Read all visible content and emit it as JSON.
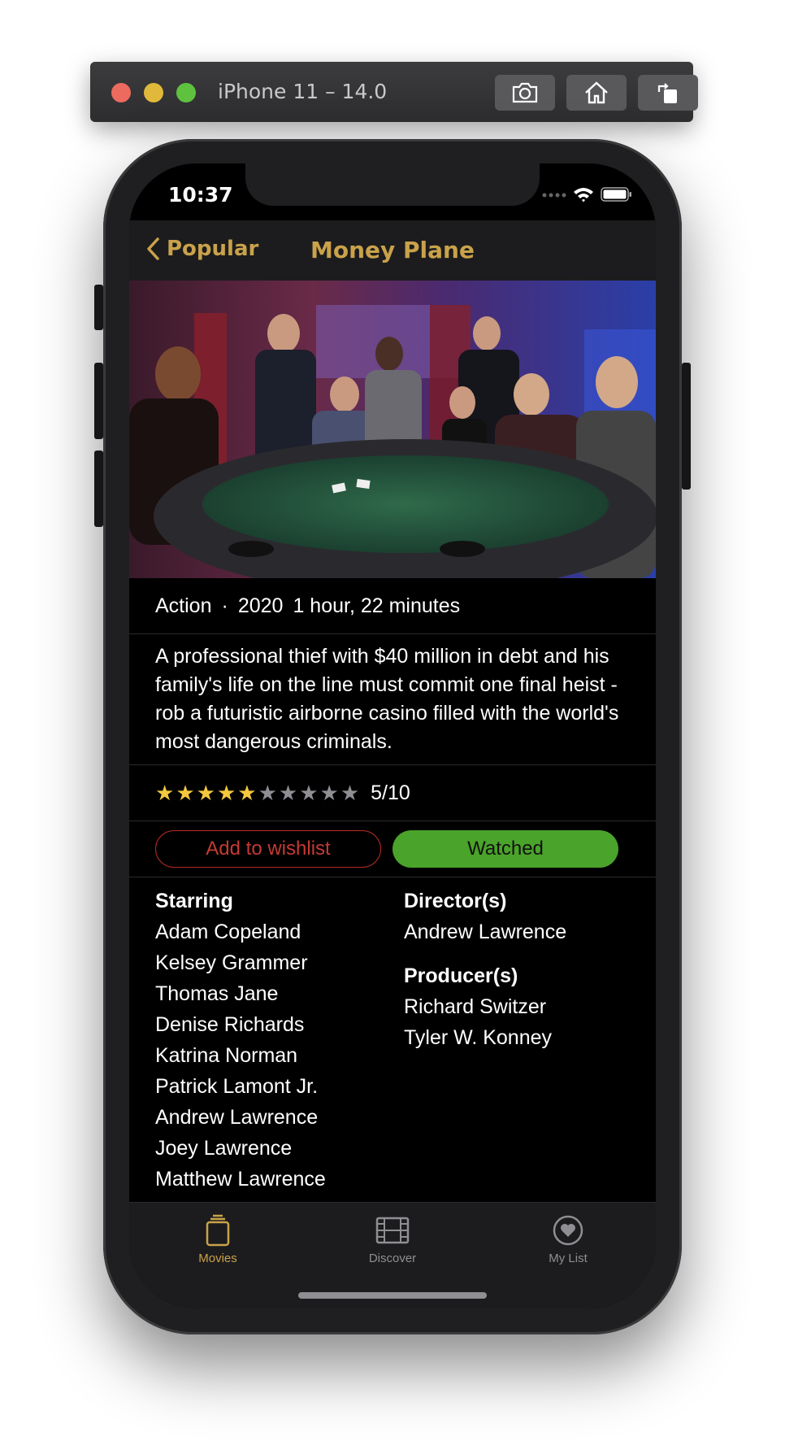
{
  "simulator": {
    "title": "iPhone 11 – 14.0",
    "buttons": [
      {
        "icon": "camera-icon"
      },
      {
        "icon": "home-icon"
      },
      {
        "icon": "rotate-icon"
      }
    ]
  },
  "status_bar": {
    "time": "10:37"
  },
  "nav": {
    "back_label": "Popular",
    "title": "Money Plane"
  },
  "movie": {
    "genre": "Action",
    "separator": "·",
    "year": "2020",
    "runtime": "1 hour, 22 minutes",
    "overview": "A professional thief with $40 million in debt and his family's life on the line must commit one final heist - rob a futuristic airborne casino filled with the world's most dangerous criminals.",
    "rating_value": 5,
    "rating_max": 10,
    "rating_text": "5/10"
  },
  "actions": {
    "wishlist_label": "Add to wishlist",
    "watched_label": "Watched"
  },
  "credits": {
    "starring_title": "Starring",
    "starring": [
      "Adam Copeland",
      "Kelsey Grammer",
      "Thomas Jane",
      "Denise Richards",
      "Katrina Norman",
      "Patrick Lamont Jr.",
      "Andrew Lawrence",
      "Joey Lawrence",
      "Matthew Lawrence"
    ],
    "directors_title": "Director(s)",
    "directors": [
      "Andrew Lawrence"
    ],
    "producers_title": "Producer(s)",
    "producers": [
      "Richard Switzer",
      "Tyler W. Konney"
    ]
  },
  "tabs": [
    {
      "label": "Movies",
      "icon": "movies-icon",
      "active": true
    },
    {
      "label": "Discover",
      "icon": "film-icon",
      "active": false
    },
    {
      "label": "My List",
      "icon": "heart-icon",
      "active": false
    }
  ],
  "colors": {
    "accent": "#c9a24a",
    "wishlist": "#c43a33",
    "watched": "#4aa32a",
    "star_filled": "#f4c93e",
    "star_empty": "#8e8e93"
  }
}
